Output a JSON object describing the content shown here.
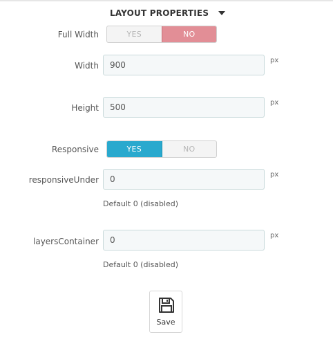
{
  "section": {
    "title": "LAYOUT PROPERTIES"
  },
  "full_width": {
    "label": "Full Width",
    "yes": "YES",
    "no": "NO",
    "selected": "NO"
  },
  "width": {
    "label": "Width",
    "value": "900",
    "unit": "px"
  },
  "height": {
    "label": "Height",
    "value": "500",
    "unit": "px"
  },
  "responsive": {
    "label": "Responsive",
    "yes": "YES",
    "no": "NO",
    "selected": "YES"
  },
  "responsive_under": {
    "label": "responsiveUnder",
    "value": "0",
    "unit": "px",
    "help": "Default 0 (disabled)"
  },
  "layers_container": {
    "label": "layersContainer",
    "value": "0",
    "unit": "px",
    "help": "Default 0 (disabled)"
  },
  "save": {
    "label": "Save",
    "icon": "floppy-disk-icon"
  },
  "colors": {
    "no_active": "#e28e96",
    "yes_active": "#29a9ce",
    "input_bg": "#f5f8f9"
  }
}
